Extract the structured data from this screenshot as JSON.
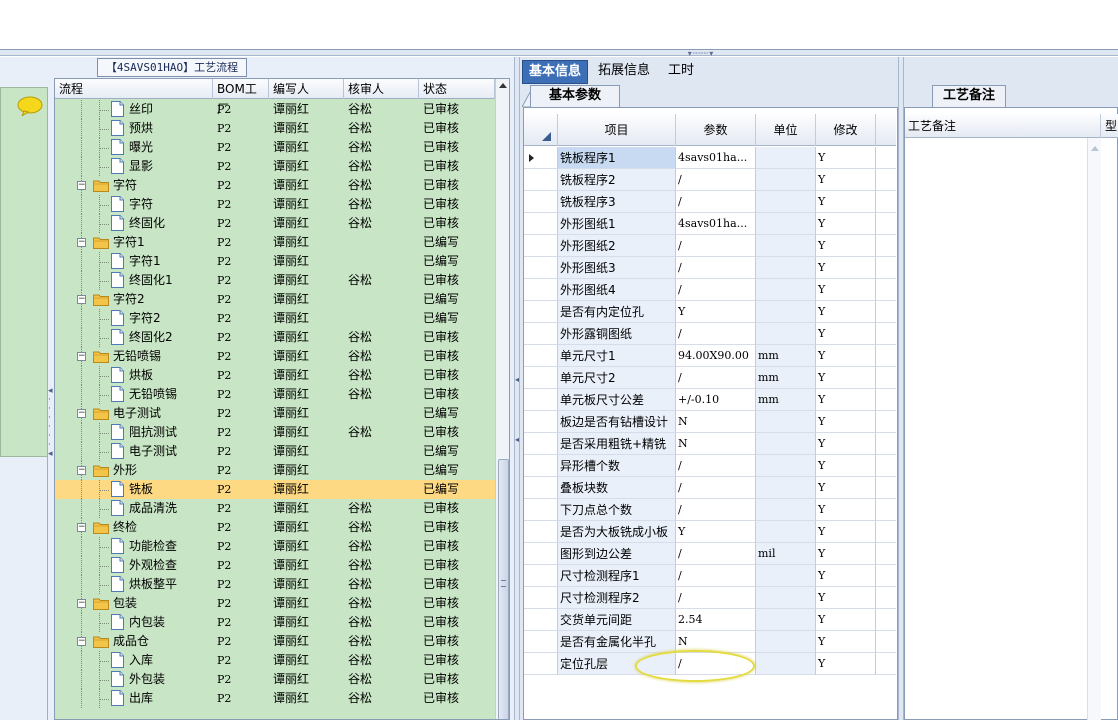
{
  "colors": {
    "tree_bg": "#c8e5c5",
    "selected_row": "#fdd984",
    "active_tab": "#3d6fb6",
    "highlight_ellipse": "#e3db3f"
  },
  "left": {
    "group_title": "【4SAVS01HAO】工艺流程",
    "tree_headers": {
      "flow": "流程",
      "bom": "BOM工厂",
      "writer": "编写人",
      "reviewer": "核审人",
      "state": "状态"
    },
    "rows": [
      {
        "level": 2,
        "type": "doc",
        "name": "丝印",
        "bom": "P2",
        "writer": "谭丽红",
        "reviewer": "谷松",
        "state": "已审核"
      },
      {
        "level": 2,
        "type": "doc",
        "name": "预烘",
        "bom": "P2",
        "writer": "谭丽红",
        "reviewer": "谷松",
        "state": "已审核"
      },
      {
        "level": 2,
        "type": "doc",
        "name": "曝光",
        "bom": "P2",
        "writer": "谭丽红",
        "reviewer": "谷松",
        "state": "已审核"
      },
      {
        "level": 2,
        "type": "doc",
        "name": "显影",
        "bom": "P2",
        "writer": "谭丽红",
        "reviewer": "谷松",
        "state": "已审核"
      },
      {
        "level": 1,
        "type": "folder",
        "name": "字符",
        "bom": "P2",
        "writer": "谭丽红",
        "reviewer": "谷松",
        "state": "已审核"
      },
      {
        "level": 2,
        "type": "doc",
        "name": "字符",
        "bom": "P2",
        "writer": "谭丽红",
        "reviewer": "谷松",
        "state": "已审核"
      },
      {
        "level": 2,
        "type": "doc",
        "name": "终固化",
        "bom": "P2",
        "writer": "谭丽红",
        "reviewer": "谷松",
        "state": "已审核"
      },
      {
        "level": 1,
        "type": "folder",
        "name": "字符1",
        "bom": "P2",
        "writer": "谭丽红",
        "reviewer": "",
        "state": "已编写"
      },
      {
        "level": 2,
        "type": "doc",
        "name": "字符1",
        "bom": "P2",
        "writer": "谭丽红",
        "reviewer": "",
        "state": "已编写"
      },
      {
        "level": 2,
        "type": "doc",
        "name": "终固化1",
        "bom": "P2",
        "writer": "谭丽红",
        "reviewer": "谷松",
        "state": "已审核"
      },
      {
        "level": 1,
        "type": "folder",
        "name": "字符2",
        "bom": "P2",
        "writer": "谭丽红",
        "reviewer": "",
        "state": "已编写"
      },
      {
        "level": 2,
        "type": "doc",
        "name": "字符2",
        "bom": "P2",
        "writer": "谭丽红",
        "reviewer": "",
        "state": "已编写"
      },
      {
        "level": 2,
        "type": "doc",
        "name": "终固化2",
        "bom": "P2",
        "writer": "谭丽红",
        "reviewer": "谷松",
        "state": "已审核"
      },
      {
        "level": 1,
        "type": "folder",
        "name": "无铅喷锡",
        "bom": "P2",
        "writer": "谭丽红",
        "reviewer": "谷松",
        "state": "已审核"
      },
      {
        "level": 2,
        "type": "doc",
        "name": "烘板",
        "bom": "P2",
        "writer": "谭丽红",
        "reviewer": "谷松",
        "state": "已审核"
      },
      {
        "level": 2,
        "type": "doc",
        "name": "无铅喷锡",
        "bom": "P2",
        "writer": "谭丽红",
        "reviewer": "谷松",
        "state": "已审核"
      },
      {
        "level": 1,
        "type": "folder",
        "name": "电子测试",
        "bom": "P2",
        "writer": "谭丽红",
        "reviewer": "",
        "state": "已编写"
      },
      {
        "level": 2,
        "type": "doc",
        "name": "阻抗测试",
        "bom": "P2",
        "writer": "谭丽红",
        "reviewer": "谷松",
        "state": "已审核"
      },
      {
        "level": 2,
        "type": "doc",
        "name": "电子测试",
        "bom": "P2",
        "writer": "谭丽红",
        "reviewer": "",
        "state": "已编写"
      },
      {
        "level": 1,
        "type": "folder",
        "name": "外形",
        "bom": "P2",
        "writer": "谭丽红",
        "reviewer": "",
        "state": "已编写"
      },
      {
        "level": 2,
        "type": "doc",
        "name": "铣板",
        "bom": "P2",
        "writer": "谭丽红",
        "reviewer": "",
        "state": "已编写",
        "selected": true
      },
      {
        "level": 2,
        "type": "doc",
        "name": "成品清洗",
        "bom": "P2",
        "writer": "谭丽红",
        "reviewer": "谷松",
        "state": "已审核"
      },
      {
        "level": 1,
        "type": "folder",
        "name": "终检",
        "bom": "P2",
        "writer": "谭丽红",
        "reviewer": "谷松",
        "state": "已审核"
      },
      {
        "level": 2,
        "type": "doc",
        "name": "功能检查",
        "bom": "P2",
        "writer": "谭丽红",
        "reviewer": "谷松",
        "state": "已审核"
      },
      {
        "level": 2,
        "type": "doc",
        "name": "外观检查",
        "bom": "P2",
        "writer": "谭丽红",
        "reviewer": "谷松",
        "state": "已审核"
      },
      {
        "level": 2,
        "type": "doc",
        "name": "烘板整平",
        "bom": "P2",
        "writer": "谭丽红",
        "reviewer": "谷松",
        "state": "已审核"
      },
      {
        "level": 1,
        "type": "folder",
        "name": "包装",
        "bom": "P2",
        "writer": "谭丽红",
        "reviewer": "谷松",
        "state": "已审核"
      },
      {
        "level": 2,
        "type": "doc",
        "name": "内包装",
        "bom": "P2",
        "writer": "谭丽红",
        "reviewer": "谷松",
        "state": "已审核"
      },
      {
        "level": 1,
        "type": "folder",
        "name": "成品仓",
        "bom": "P2",
        "writer": "谭丽红",
        "reviewer": "谷松",
        "state": "已审核"
      },
      {
        "level": 2,
        "type": "doc",
        "name": "入库",
        "bom": "P2",
        "writer": "谭丽红",
        "reviewer": "谷松",
        "state": "已审核"
      },
      {
        "level": 2,
        "type": "doc",
        "name": "外包装",
        "bom": "P2",
        "writer": "谭丽红",
        "reviewer": "谷松",
        "state": "已审核"
      },
      {
        "level": 2,
        "type": "doc",
        "name": "出库",
        "bom": "P2",
        "writer": "谭丽红",
        "reviewer": "谷松",
        "state": "已审核"
      }
    ]
  },
  "center": {
    "tabs": [
      "基本信息",
      "拓展信息",
      "工时"
    ],
    "subtab": "基本参数",
    "grid_headers": {
      "item": "项目",
      "param": "参数",
      "unit": "单位",
      "edit": "修改"
    },
    "rows": [
      {
        "item": "铣板程序1",
        "param": "4savs01ha...",
        "unit": "",
        "edit": "Y",
        "current": true
      },
      {
        "item": "铣板程序2",
        "param": "/",
        "unit": "",
        "edit": "Y"
      },
      {
        "item": "铣板程序3",
        "param": "/",
        "unit": "",
        "edit": "Y"
      },
      {
        "item": "外形图纸1",
        "param": "4savs01ha...",
        "unit": "",
        "edit": "Y"
      },
      {
        "item": "外形图纸2",
        "param": "/",
        "unit": "",
        "edit": "Y"
      },
      {
        "item": "外形图纸3",
        "param": "/",
        "unit": "",
        "edit": "Y"
      },
      {
        "item": "外形图纸4",
        "param": "/",
        "unit": "",
        "edit": "Y"
      },
      {
        "item": "是否有内定位孔",
        "param": "Y",
        "unit": "",
        "edit": "Y"
      },
      {
        "item": "外形露铜图纸",
        "param": "/",
        "unit": "",
        "edit": "Y"
      },
      {
        "item": "单元尺寸1",
        "param": "94.00X90.00",
        "unit": "mm",
        "edit": "Y"
      },
      {
        "item": "单元尺寸2",
        "param": "/",
        "unit": "mm",
        "edit": "Y"
      },
      {
        "item": "单元板尺寸公差",
        "param": "+/-0.10",
        "unit": "mm",
        "edit": "Y"
      },
      {
        "item": "板边是否有钻槽设计",
        "param": "N",
        "unit": "",
        "edit": "Y"
      },
      {
        "item": "是否采用粗铣+精铣",
        "param": "N",
        "unit": "",
        "edit": "Y"
      },
      {
        "item": "异形槽个数",
        "param": "/",
        "unit": "",
        "edit": "Y"
      },
      {
        "item": "叠板块数",
        "param": "/",
        "unit": "",
        "edit": "Y"
      },
      {
        "item": "下刀点总个数",
        "param": "/",
        "unit": "",
        "edit": "Y"
      },
      {
        "item": "是否为大板铣成小板",
        "param": "Y",
        "unit": "",
        "edit": "Y"
      },
      {
        "item": "图形到边公差",
        "param": "/",
        "unit": "mil",
        "edit": "Y"
      },
      {
        "item": "尺寸检测程序1",
        "param": "/",
        "unit": "",
        "edit": "Y"
      },
      {
        "item": "尺寸检测程序2",
        "param": "/",
        "unit": "",
        "edit": "Y"
      },
      {
        "item": "交货单元间距",
        "param": "2.54",
        "unit": "",
        "edit": "Y"
      },
      {
        "item": "是否有金属化半孔",
        "param": "N",
        "unit": "",
        "edit": "Y"
      },
      {
        "item": "定位孔层",
        "param": "/",
        "unit": "",
        "edit": "Y"
      }
    ]
  },
  "right": {
    "subtab": "工艺备注",
    "header": "工艺备注",
    "header2": "型"
  }
}
